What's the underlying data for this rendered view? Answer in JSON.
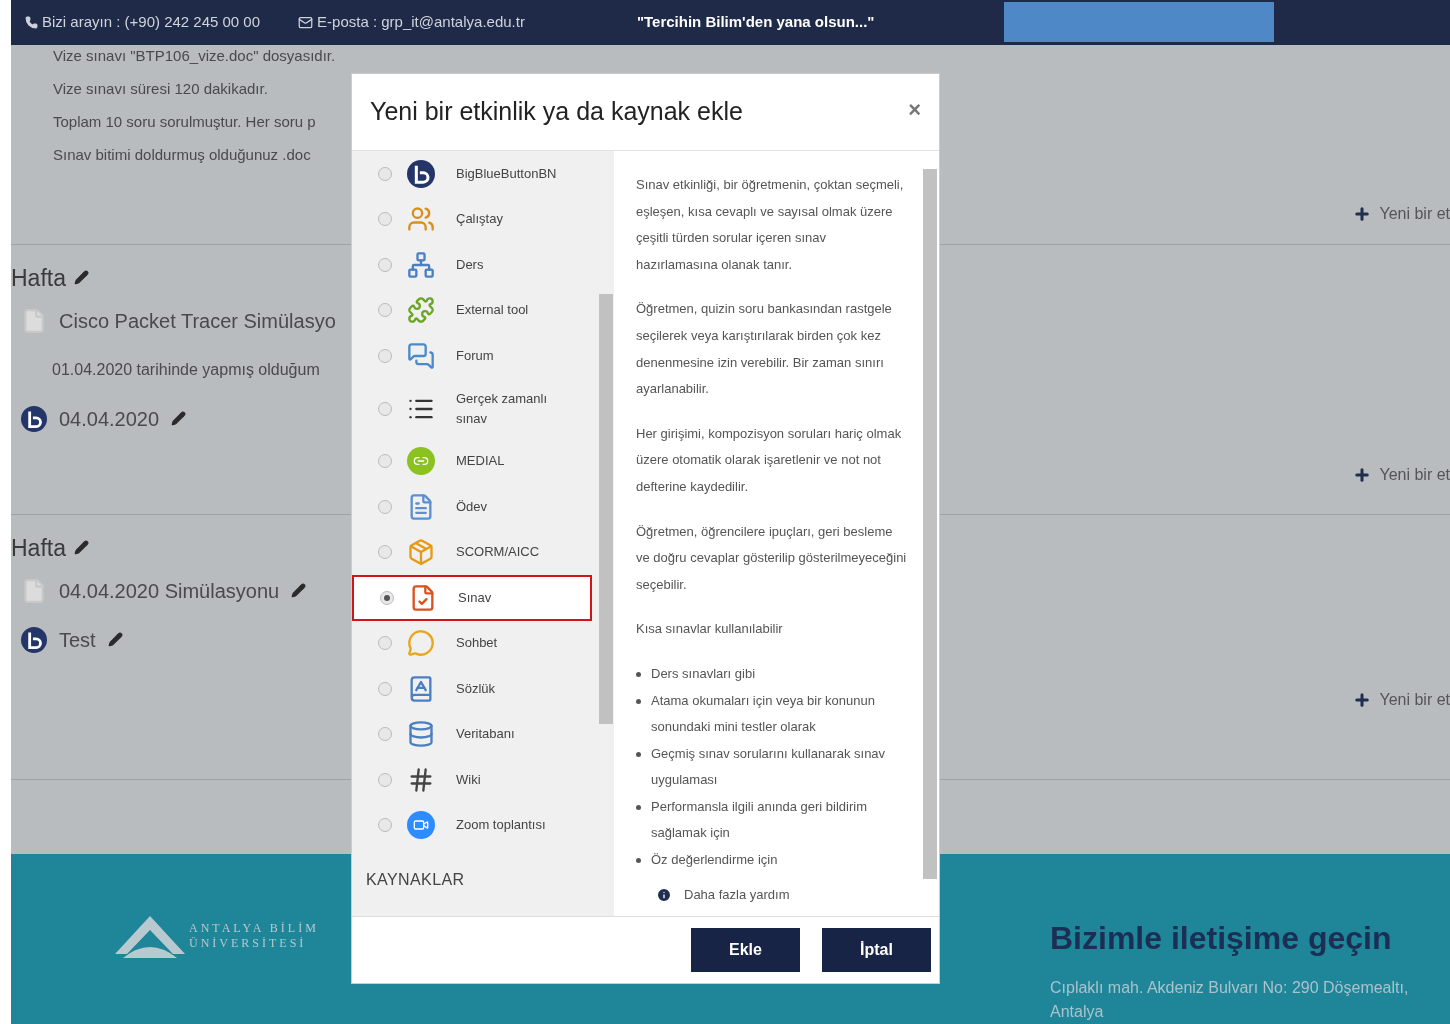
{
  "top_bar": {
    "phone": "Bizi arayın : (+90) 242 245 00 00",
    "email": "E-posta : grp_it@antalya.edu.tr",
    "slogan": "\"Tercihin Bilim'den yana olsun...\""
  },
  "intro_lines": [
    "Vize sınavı \"BTP106_vize.doc\" dosyasıdır.",
    "Vize sınavı süresi 120 dakikadır.",
    "Toplam 10 soru sorulmuştur. Her soru p",
    "Sınav bitimi doldurmuş olduğunuz .doc"
  ],
  "intro_add_link": "Yeni bir et",
  "sections": [
    {
      "title": "Hafta",
      "items": [
        {
          "kind": "file",
          "label": "Cisco Packet Tracer Simülasyo",
          "editable": false
        },
        {
          "kind": "note",
          "label": "01.04.2020 tarihinde yapmış olduğum",
          "editable": false
        },
        {
          "kind": "meeting",
          "label": "04.04.2020",
          "editable": true
        }
      ],
      "add_link": "Yeni bir et"
    },
    {
      "title": "Hafta",
      "items": [
        {
          "kind": "file",
          "label": "04.04.2020 Simülasyonu",
          "editable": true
        },
        {
          "kind": "meeting",
          "label": "Test",
          "editable": true
        }
      ],
      "add_link": "Yeni bir et"
    }
  ],
  "modal": {
    "title": "Yeni bir etkinlik ya da kaynak ekle",
    "close": "×",
    "options": [
      {
        "label": "BigBlueButtonBN",
        "selected": false
      },
      {
        "label": "Çalıştay",
        "selected": false
      },
      {
        "label": "Ders",
        "selected": false
      },
      {
        "label": "External tool",
        "selected": false
      },
      {
        "label": "Forum",
        "selected": false
      },
      {
        "label": "Gerçek zamanlı sınav",
        "selected": false
      },
      {
        "label": "MEDIAL",
        "selected": false
      },
      {
        "label": "Ödev",
        "selected": false
      },
      {
        "label": "SCORM/AICC",
        "selected": false
      },
      {
        "label": "Sınav",
        "selected": true
      },
      {
        "label": "Sohbet",
        "selected": false
      },
      {
        "label": "Sözlük",
        "selected": false
      },
      {
        "label": "Veritabanı",
        "selected": false
      },
      {
        "label": "Wiki",
        "selected": false
      },
      {
        "label": "Zoom toplantısı",
        "selected": false
      }
    ],
    "resources_heading": "KAYNAKLAR",
    "description": [
      "Sınav etkinliği, bir öğretmenin, çoktan seçmeli, eşleşen, kısa cevaplı ve sayısal olmak üzere çeşitli türden sorular içeren sınav hazırlamasına olanak tanır.",
      "Öğretmen, quizin soru bankasından rastgele seçilerek veya karıştırılarak birden çok kez denenmesine izin verebilir. Bir zaman sınırı ayarlanabilir.",
      "Her girişimi, kompozisyon soruları hariç olmak üzere otomatik olarak işaretlenir ve not not defterine kaydedilir.",
      "Öğretmen, öğrencilere ipuçları, geri besleme ve doğru cevaplar gösterilip gösterilmeyeceğini seçebilir.",
      "Kısa sınavlar kullanılabilir"
    ],
    "bullets": [
      "Ders sınavları gibi",
      "Atama okumaları için veya bir konunun sonundaki mini testler olarak",
      "Geçmiş sınav sorularını kullanarak sınav uygulaması",
      "Performansla ilgili anında geri bildirim sağlamak için",
      "Öz değerlendirme için"
    ],
    "help_link": "Daha fazla yardım",
    "buttons": [
      "Ekle",
      "İptal"
    ]
  },
  "footer": {
    "logo_name": "ANTALYA BİLİM",
    "logo_sub": "ÜNİVERSİTESİ",
    "contact_title": "Bizimle iletişime geçin",
    "address": "Cıplaklı mah. Akdeniz Bulvarı No: 290 Döşemealtı, Antalya"
  }
}
